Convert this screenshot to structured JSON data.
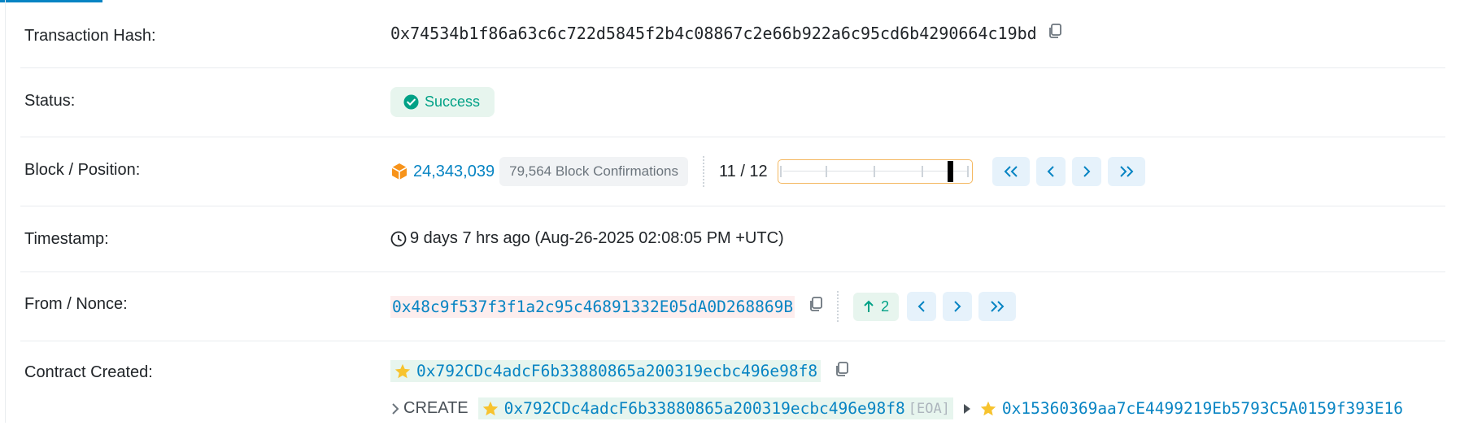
{
  "rows": {
    "tx_hash": {
      "label": "Transaction Hash:",
      "value": "0x74534b1f86a63c6c722d5845f2b4c08867c2e66b922a6c95cd6b4290664c19bd"
    },
    "status": {
      "label": "Status:",
      "value": "Success"
    },
    "block": {
      "label": "Block / Position:",
      "number": "24,343,039",
      "confirmations": "79,564 Block Confirmations",
      "position": "11 / 12",
      "position_fraction": 0.909
    },
    "timestamp": {
      "label": "Timestamp:",
      "value": "9 days 7 hrs ago (Aug-26-2025 02:08:05 PM +UTC)"
    },
    "from": {
      "label": "From / Nonce:",
      "address": "0x48c9f537f3f1a2c95c46891332E05dA0D268869B",
      "nonce": "2"
    },
    "contract": {
      "label": "Contract Created:",
      "address": "0x792CDc4adcF6b33880865a200319ecbc496e98f8",
      "trace_action": "CREATE",
      "trace_from": "0x792CDc4adcF6b33880865a200319ecbc496e98f8",
      "trace_from_tag": "[EOA]",
      "trace_to": "0x15360369aa7cE4499219Eb5793C5A0159f393E16"
    }
  },
  "colors": {
    "link": "#0784c3",
    "success": "#00a186",
    "block_icon": "#f7931a",
    "slider_border": "#f4b860"
  },
  "icons": [
    "copy-icon",
    "check-circle-icon",
    "cube-icon",
    "clock-icon",
    "arrow-up-icon",
    "star-icon",
    "chevron-right-icon",
    "caret-right-icon"
  ]
}
